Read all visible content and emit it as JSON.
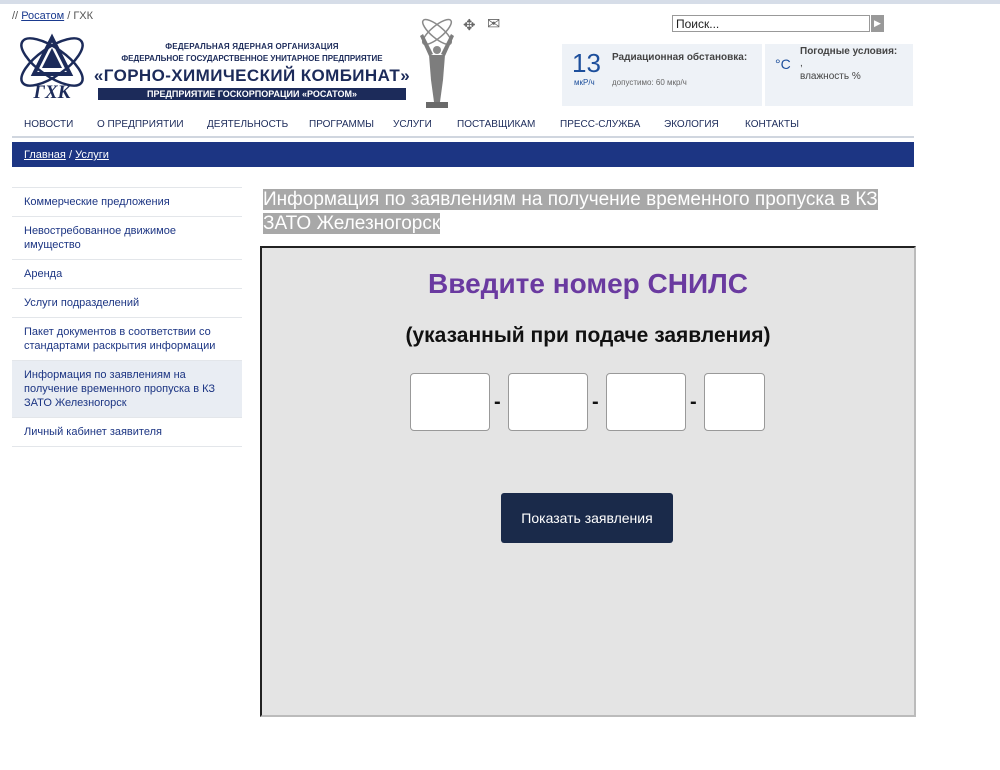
{
  "top_breadcrumb": {
    "prefix": "//",
    "link": "Росатом",
    "sep": "/",
    "current": "ГХК"
  },
  "logo": {
    "text": "ГХК"
  },
  "org": {
    "line1": "ФЕДЕРАЛЬНАЯ ЯДЕРНАЯ ОРГАНИЗАЦИЯ",
    "line2": "ФЕДЕРАЛЬНОЕ ГОСУДАРСТВЕННОЕ УНИТАРНОЕ ПРЕДПРИЯТИЕ",
    "line3": "«ГОРНО-ХИМИЧЕСКИЙ КОМБИНАТ»",
    "line4": "ПРЕДПРИЯТИЕ ГОСКОРПОРАЦИИ «РОСАТОМ»"
  },
  "icons": {
    "move": "move-icon",
    "mail": "mail-icon",
    "search_go": "arrow-right-icon"
  },
  "search": {
    "value": "Поиск..."
  },
  "radiation": {
    "value": "13",
    "unit": "мкР/ч",
    "title": "Радиационная обстановка:",
    "allowed": "допустимо: 60 мкр/ч"
  },
  "weather": {
    "title": "Погодные условия:",
    "unit": "°C",
    "dot": ",",
    "humidity": "влажность %"
  },
  "nav": [
    "НОВОСТИ",
    "О ПРЕДПРИЯТИИ",
    "ДЕЯТЕЛЬНОСТЬ",
    "ПРОГРАММЫ",
    "УСЛУГИ",
    "ПОСТАВЩИКАМ",
    "ПРЕСС-СЛУЖБА",
    "ЭКОЛОГИЯ",
    "КОНТАКТЫ"
  ],
  "breadcrumb": {
    "home": "Главная",
    "sep": "/",
    "current": "Услуги"
  },
  "sidebar": [
    {
      "label": "Коммерческие предложения"
    },
    {
      "label": "Невостребованное движимое имущество"
    },
    {
      "label": "Аренда"
    },
    {
      "label": "Услуги подразделений"
    },
    {
      "label": "Пакет документов в соответствии со стандартами раскрытия информации"
    },
    {
      "label": "Информация по заявлениям на получение временного пропуска в КЗ ЗАТО Железногорск"
    },
    {
      "label": "Личный кабинет заявителя"
    }
  ],
  "page_title": "Информация по заявлениям на получение временного пропуска в КЗ ЗАТО Железногорск",
  "form": {
    "heading": "Введите номер СНИЛС",
    "subheading": "(указанный при подаче заявления)",
    "fields": [
      "",
      "",
      "",
      ""
    ],
    "separator": "-",
    "button": "Показать заявления"
  },
  "colors": {
    "brand": "#1c3583",
    "heading": "#6a3aa0",
    "button": "#1a2a4a",
    "panel": "#e4e4e4"
  }
}
